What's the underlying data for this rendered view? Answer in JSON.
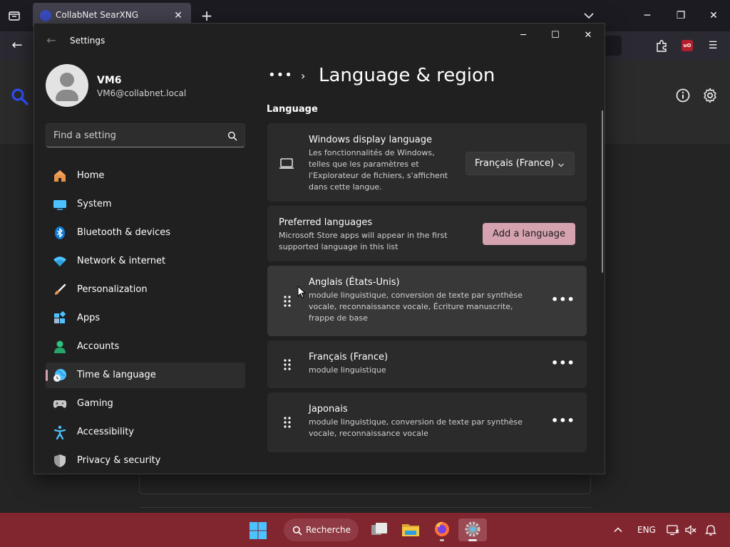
{
  "browser": {
    "tab_title": "CollabNet SearXNG",
    "tab_close": "✕",
    "new_tab": "+",
    "win_minimize": "─",
    "win_restore": "❐",
    "win_close": "✕",
    "back": "←",
    "menu": "☰"
  },
  "settings": {
    "window_title": "Settings",
    "back": "←",
    "min": "─",
    "max": "☐",
    "close": "✕",
    "profile": {
      "name": "VM6",
      "email": "VM6@collabnet.local"
    },
    "search_placeholder": "Find a setting",
    "nav": [
      {
        "label": "Home",
        "icon": "home-icon"
      },
      {
        "label": "System",
        "icon": "system-icon"
      },
      {
        "label": "Bluetooth & devices",
        "icon": "bluetooth-icon"
      },
      {
        "label": "Network & internet",
        "icon": "network-icon"
      },
      {
        "label": "Personalization",
        "icon": "personalization-icon"
      },
      {
        "label": "Apps",
        "icon": "apps-icon"
      },
      {
        "label": "Accounts",
        "icon": "accounts-icon"
      },
      {
        "label": "Time & language",
        "icon": "time-language-icon",
        "selected": true
      },
      {
        "label": "Gaming",
        "icon": "gaming-icon"
      },
      {
        "label": "Accessibility",
        "icon": "accessibility-icon"
      },
      {
        "label": "Privacy & security",
        "icon": "privacy-icon"
      }
    ],
    "breadcrumb_dots": "•••",
    "breadcrumb_chevron": "›",
    "page_title": "Language & region",
    "section_language": "Language",
    "display_language": {
      "title": "Windows display language",
      "desc": "Les fonctionnalités de Windows, telles que les paramètres et l'Explorateur de fichiers, s'affichent dans cette langue.",
      "value": "Français (France)"
    },
    "preferred": {
      "title": "Preferred languages",
      "desc": "Microsoft Store apps will appear in the first supported language in this list",
      "add_button": "Add a language"
    },
    "languages": [
      {
        "name": "Anglais (États-Unis)",
        "desc": "module linguistique, conversion de texte par synthèse vocale, reconnaissance vocale, Écriture manuscrite, frappe de base"
      },
      {
        "name": "Français (France)",
        "desc": "module linguistique"
      },
      {
        "name": "Japonais",
        "desc": "module linguistique, conversion de texte par synthèse vocale, reconnaissance vocale"
      }
    ],
    "more": "•••"
  },
  "taskbar": {
    "search_label": "Recherche",
    "lang": "ENG",
    "accent": "#81262f"
  },
  "colors": {
    "accent": "#d5a3b0",
    "card": "#2b2b2b",
    "window": "#202020"
  }
}
